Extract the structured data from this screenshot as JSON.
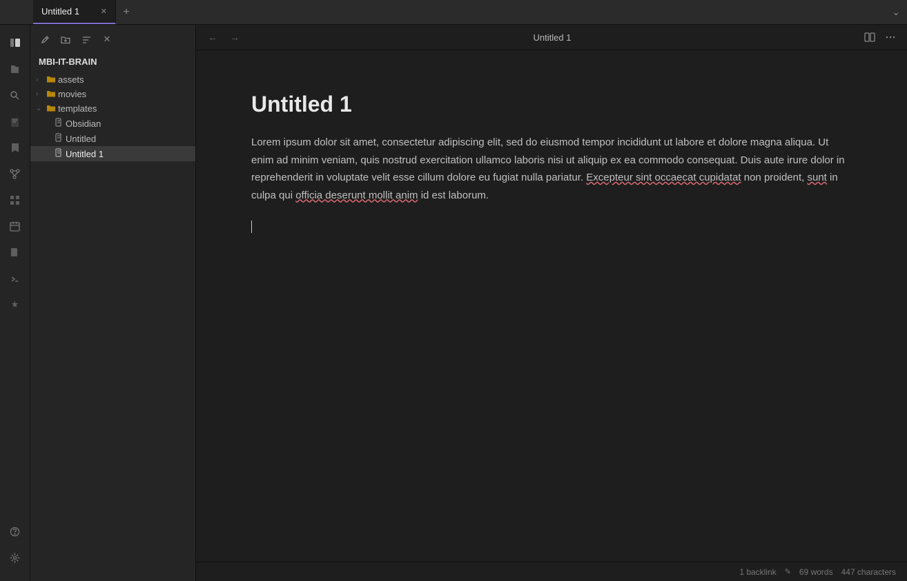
{
  "titlebar": {
    "tab_label": "Untitled 1",
    "add_tab_label": "+",
    "chevron_down": "⌄",
    "more_icon": "⋯"
  },
  "sidebar_icons": {
    "toggle_sidebar": "☰",
    "open_file": "📂",
    "search": "🔍",
    "new_note": "📄",
    "bookmark": "🔖",
    "branches": "⑂",
    "blocks": "⊞",
    "calendar": "📅",
    "pages": "📋",
    "terminal": "▶",
    "plugins": "🎬",
    "help": "?",
    "settings": "⚙"
  },
  "sidebar": {
    "vault_name": "MBI-IT-BRAIN",
    "tools": {
      "new_note": "✏",
      "new_folder": "📁",
      "sort": "↕",
      "close": "✕"
    },
    "tree": [
      {
        "label": "assets",
        "type": "folder",
        "collapsed": true,
        "indent": 0
      },
      {
        "label": "movies",
        "type": "folder",
        "collapsed": true,
        "indent": 0
      },
      {
        "label": "templates",
        "type": "folder",
        "collapsed": false,
        "indent": 0
      },
      {
        "label": "Obsidian",
        "type": "file",
        "indent": 1
      },
      {
        "label": "Untitled",
        "type": "file",
        "indent": 1
      },
      {
        "label": "Untitled 1",
        "type": "file",
        "indent": 1,
        "active": true
      }
    ]
  },
  "editor": {
    "title": "Untitled 1",
    "nav_back": "←",
    "nav_forward": "→",
    "reading_view_icon": "📖",
    "more_icon": "⋯",
    "doc_title": "Untitled 1",
    "doc_body": "Lorem ipsum dolor sit amet, consectetur adipiscing elit, sed do eiusmod tempor incididunt ut labore et dolore magna aliqua. Ut enim ad minim veniam, quis nostrud exercitation ullamco laboris nisi ut aliquip ex ea commodo consequat. Duis aute irure dolor in reprehenderit in voluptate velit esse cillum dolore eu fugiat nulla pariatur. ",
    "doc_spellcheck_1": "Excepteur sint occaecat cupidatat",
    "doc_body_2": " non proident, ",
    "doc_spellcheck_2": "sunt",
    "doc_body_3": " in culpa qui ",
    "doc_spellcheck_3": "officia deserunt mollit anim",
    "doc_body_4": " id est laborum."
  },
  "statusbar": {
    "backlinks": "1 backlink",
    "edit_icon": "✎",
    "word_count": "69 words",
    "char_count": "447 characters"
  }
}
